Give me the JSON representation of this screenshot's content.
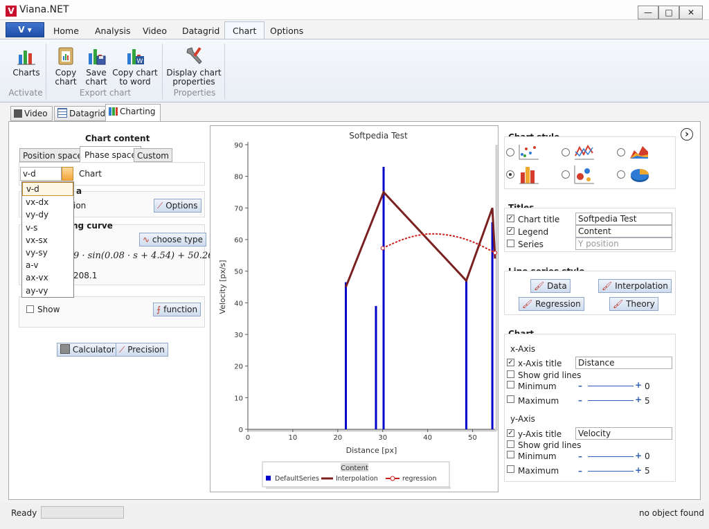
{
  "window": {
    "title": "Viana.NET",
    "logo": "V",
    "minimize": "—",
    "maximize": "□",
    "close": "✕"
  },
  "app_menu": {
    "label": "V ▾"
  },
  "ribbon_tabs": [
    "Home",
    "Analysis",
    "Video",
    "Datagrid",
    "Chart",
    "Options"
  ],
  "ribbon": {
    "charts": "Charts",
    "copy_chart": [
      "Copy",
      "chart"
    ],
    "save_chart": [
      "Save",
      "chart"
    ],
    "copy_to_word": [
      "Copy chart",
      "to word"
    ],
    "display_props": [
      "Display chart",
      "properties"
    ],
    "group_activate": "Activate",
    "group_export": "Export chart",
    "group_properties": "Properties"
  },
  "doc_tabs": [
    "Video",
    "Datagrid",
    "Charting"
  ],
  "left": {
    "title": "Chart content",
    "tabs": [
      "Position space",
      "Phase space",
      "Custom"
    ],
    "combo_value": "v-d",
    "chart_label": "Chart",
    "dropdown": [
      "v-d",
      "vx-dx",
      "vy-dy",
      "v-s",
      "vx-sx",
      "vy-sy",
      "a-v",
      "ax-vx",
      "ay-vy"
    ],
    "data_fragment": "a",
    "option_fragment": "ion",
    "options_btn": "Options",
    "fit_fragment": "ng curve",
    "choose_type_btn": "choose type",
    "formula": "9 · sin(0.08 · s + 4.54) + 50.26",
    "value_fragment": "208.1",
    "show_label": "Show",
    "function_btn": "function",
    "calculator_btn": "Calculator",
    "precision_btn": "Precision"
  },
  "chart_data": {
    "type": "bar",
    "title": "Softpedia Test",
    "xlabel": "Distance  [px]",
    "ylabel": "Velocity  [px/s]",
    "xlim": [
      0,
      55
    ],
    "ylim": [
      0,
      90
    ],
    "x_ticks": [
      0,
      10,
      20,
      30,
      40,
      50
    ],
    "y_ticks": [
      0,
      10,
      20,
      30,
      40,
      50,
      60,
      70,
      80,
      90
    ],
    "legend_title": "Content",
    "legend_position": "bottom",
    "series": [
      {
        "name": "DefaultSeries",
        "type": "bar",
        "color": "#0000cc",
        "points": [
          [
            21.8,
            46.5
          ],
          [
            28.5,
            39
          ],
          [
            30.2,
            83
          ],
          [
            48.6,
            47
          ],
          [
            54.4,
            65.5
          ]
        ]
      },
      {
        "name": "Interpolation",
        "type": "line",
        "color": "#7b2020",
        "points": [
          [
            21.8,
            45
          ],
          [
            30.2,
            75
          ],
          [
            48.6,
            47
          ],
          [
            54.4,
            70
          ],
          [
            55,
            54
          ]
        ]
      },
      {
        "name": "regression",
        "type": "line",
        "color": "#cc1b1b",
        "points": [
          [
            30,
            57.3
          ],
          [
            35,
            60.5
          ],
          [
            40,
            62
          ],
          [
            45,
            61.5
          ],
          [
            50,
            59.5
          ],
          [
            55,
            55.8
          ]
        ]
      }
    ]
  },
  "right": {
    "chart_style_title": "Chart style",
    "titles_title": "Titles",
    "chart_title_label": "Chart title",
    "chart_title_value": "Softpedia Test",
    "legend_label": "Legend",
    "legend_value": "Content",
    "series_label": "Series",
    "series_placeholder": "Y position",
    "line_style_title": "Line series style",
    "data_btn": "Data",
    "interp_btn": "Interpolation",
    "regression_btn": "Regression",
    "theory_btn": "Theory",
    "chart_title": "Chart",
    "x_axis": "x-Axis",
    "x_axis_title_label": "x-Axis title",
    "x_axis_title_value": "Distance",
    "show_grid": "Show grid lines",
    "minimum": "Minimum",
    "maximum": "Maximum",
    "x_min": "0",
    "x_max": "5",
    "y_axis": "y-Axis",
    "y_axis_title_label": "y-Axis title",
    "y_axis_title_value": "Velocity",
    "y_min": "0",
    "y_max": "5",
    "expand_icon": "›"
  },
  "status": {
    "left": "Ready",
    "right": "no object found"
  },
  "colors": {
    "accent": "#1f4ea8",
    "bar": "#0000cc",
    "interpolation": "#7b2020",
    "regression": "#cc1b1b"
  }
}
